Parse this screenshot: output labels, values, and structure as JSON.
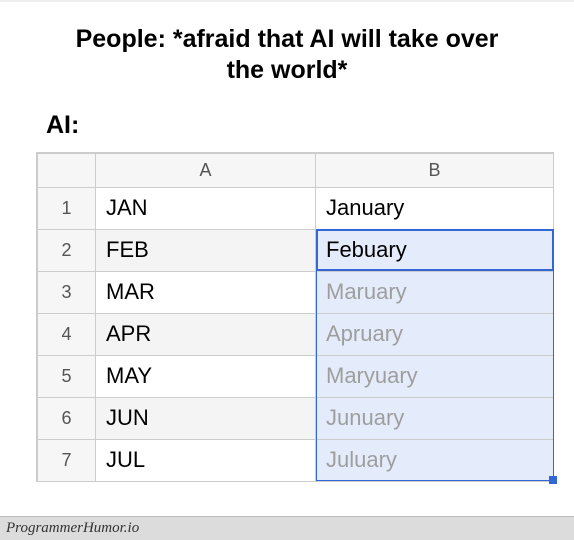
{
  "caption": {
    "line1": "People: *afraid that AI will take over",
    "line2": "the world*",
    "ai_label": "AI:"
  },
  "spreadsheet": {
    "columns": [
      "A",
      "B"
    ],
    "rows": [
      {
        "n": "1",
        "a": "JAN",
        "b": "January",
        "predicted": false
      },
      {
        "n": "2",
        "a": "FEB",
        "b": "Febuary",
        "predicted": false
      },
      {
        "n": "3",
        "a": "MAR",
        "b": "Maruary",
        "predicted": true
      },
      {
        "n": "4",
        "a": "APR",
        "b": "Apruary",
        "predicted": true
      },
      {
        "n": "5",
        "a": "MAY",
        "b": "Maryuary",
        "predicted": true
      },
      {
        "n": "6",
        "a": "JUN",
        "b": "Junuary",
        "predicted": true
      },
      {
        "n": "7",
        "a": "JUL",
        "b": "Juluary",
        "predicted": true
      }
    ],
    "active_cell_row_index": 1,
    "selection_start_row_index": 1,
    "selection_end_row_index": 6
  },
  "watermark": "ProgrammerHumor.io"
}
